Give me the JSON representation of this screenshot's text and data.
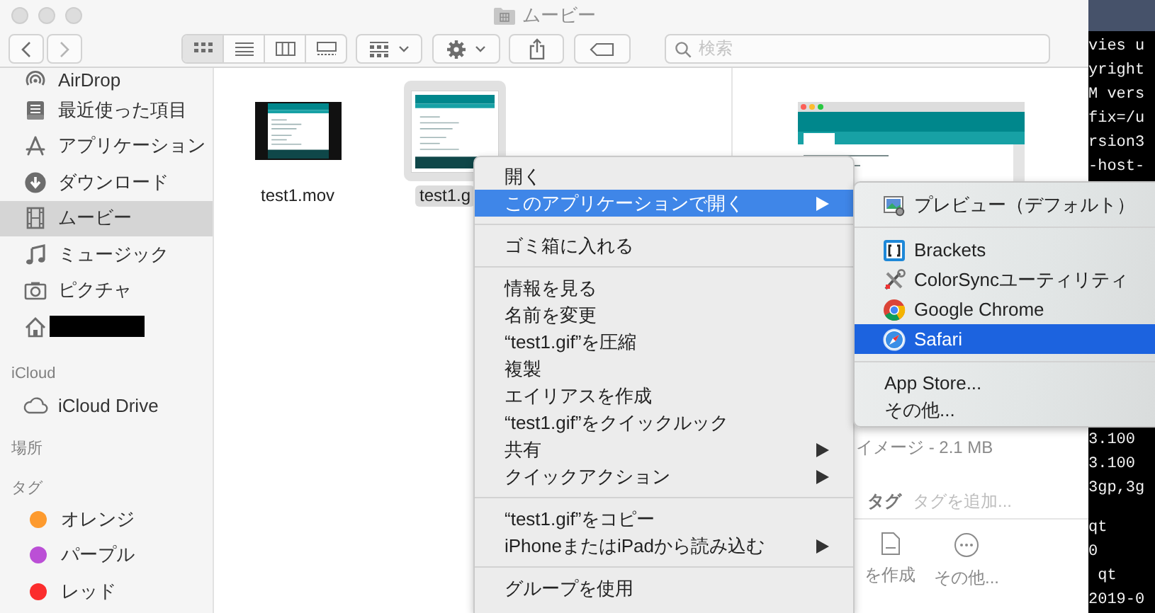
{
  "window": {
    "title": "ムービー"
  },
  "toolbar": {
    "view_modes": [
      {
        "selected": true
      },
      {
        "selected": false
      },
      {
        "selected": false
      },
      {
        "selected": false
      }
    ],
    "search": {
      "placeholder": "検索"
    }
  },
  "sidebar": {
    "favorites": [
      {
        "kind": "place",
        "label": "AirDrop",
        "selected": false
      },
      {
        "kind": "place",
        "label": "最近使った項目",
        "selected": false
      },
      {
        "kind": "place",
        "label": "アプリケーション",
        "selected": false
      },
      {
        "kind": "place",
        "label": "ダウンロード",
        "selected": false
      },
      {
        "kind": "place",
        "label": "ムービー",
        "selected": true
      },
      {
        "kind": "place",
        "label": "ミュージック",
        "selected": false
      },
      {
        "kind": "place",
        "label": "ピクチャ",
        "selected": false
      },
      {
        "kind": "redacted",
        "selected": false
      }
    ],
    "icloud": {
      "header": "iCloud",
      "items": [
        {
          "label": "iCloud Drive",
          "selected": false
        }
      ]
    },
    "locations": {
      "header": "場所"
    },
    "tags": {
      "header": "タグ",
      "items": [
        {
          "label": "オレンジ",
          "color": "#fd9a2e"
        },
        {
          "label": "パープル",
          "color": "#bb4fd6"
        },
        {
          "label": "レッド",
          "color": "#fb2d2d"
        }
      ]
    }
  },
  "files": [
    {
      "name": "test1.mov",
      "kind": "video",
      "selected": false
    },
    {
      "name": "test1.g",
      "kind": "image",
      "selected": true
    }
  ],
  "preview": {
    "info": "イメージ - 2.1 MB",
    "tags_label": "タグ",
    "tags_placeholder": "タグを追加...",
    "actions": [
      {
        "label": "を作成"
      },
      {
        "label": "その他..."
      }
    ]
  },
  "context_menu": {
    "items": [
      {
        "kind": "item",
        "label": "開く",
        "selected": false,
        "has_submenu": false
      },
      {
        "kind": "item",
        "label": "このアプリケーションで開く",
        "selected": true,
        "has_submenu": true
      },
      {
        "kind": "separator"
      },
      {
        "kind": "item",
        "label": "ゴミ箱に入れる",
        "selected": false,
        "has_submenu": false
      },
      {
        "kind": "separator"
      },
      {
        "kind": "item",
        "label": "情報を見る",
        "selected": false,
        "has_submenu": false
      },
      {
        "kind": "item",
        "label": "名前を変更",
        "selected": false,
        "has_submenu": false
      },
      {
        "kind": "item",
        "label": "“test1.gif”を圧縮",
        "selected": false,
        "has_submenu": false
      },
      {
        "kind": "item",
        "label": "複製",
        "selected": false,
        "has_submenu": false
      },
      {
        "kind": "item",
        "label": "エイリアスを作成",
        "selected": false,
        "has_submenu": false
      },
      {
        "kind": "item",
        "label": "“test1.gif”をクイックルック",
        "selected": false,
        "has_submenu": false
      },
      {
        "kind": "item",
        "label": "共有",
        "selected": false,
        "has_submenu": true
      },
      {
        "kind": "item",
        "label": "クイックアクション",
        "selected": false,
        "has_submenu": true
      },
      {
        "kind": "separator"
      },
      {
        "kind": "item",
        "label": "“test1.gif”をコピー",
        "selected": false,
        "has_submenu": false
      },
      {
        "kind": "item",
        "label": "iPhoneまたはiPadから読み込む",
        "selected": false,
        "has_submenu": true
      },
      {
        "kind": "separator"
      },
      {
        "kind": "item",
        "label": "グループを使用",
        "selected": false,
        "has_submenu": false
      }
    ]
  },
  "submenu": {
    "items": [
      {
        "kind": "app",
        "label": "プレビュー（デフォルト）",
        "selected": false
      },
      {
        "kind": "separator"
      },
      {
        "kind": "app",
        "label": "Brackets",
        "selected": false
      },
      {
        "kind": "app",
        "label": "ColorSyncユーティリティ",
        "selected": false
      },
      {
        "kind": "app",
        "label": "Google Chrome",
        "selected": false
      },
      {
        "kind": "app",
        "label": "Safari",
        "selected": true
      },
      {
        "kind": "separator"
      },
      {
        "kind": "item",
        "label": "App Store...",
        "selected": false
      },
      {
        "kind": "item",
        "label": "その他...",
        "selected": false
      }
    ]
  },
  "terminal": {
    "groups": [
      {
        "lines": [
          "vies u",
          "yright",
          "M vers",
          "fix=/u",
          "rsion3",
          "-host-"
        ]
      },
      {
        "lines": [
          "3.100",
          "3.100",
          "3gp,3g"
        ]
      },
      {
        "lines": [
          "qt",
          "0",
          " qt",
          "2019-0"
        ]
      }
    ]
  }
}
